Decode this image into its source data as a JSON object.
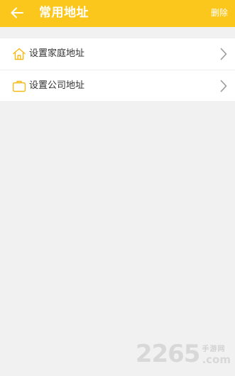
{
  "header": {
    "title": "常用地址",
    "delete_label": "删除",
    "back_icon": "arrow-left-icon",
    "background": "#fcc71c"
  },
  "addresses": [
    {
      "label": "设置家庭地址",
      "icon": "home-icon"
    },
    {
      "label": "设置公司地址",
      "icon": "briefcase-icon"
    }
  ],
  "colors": {
    "accent": "#f6b913",
    "page_bg": "#f1f1f1"
  },
  "watermark": {
    "number": "2265",
    "tagline": "手游网",
    "suffix": ".com"
  }
}
